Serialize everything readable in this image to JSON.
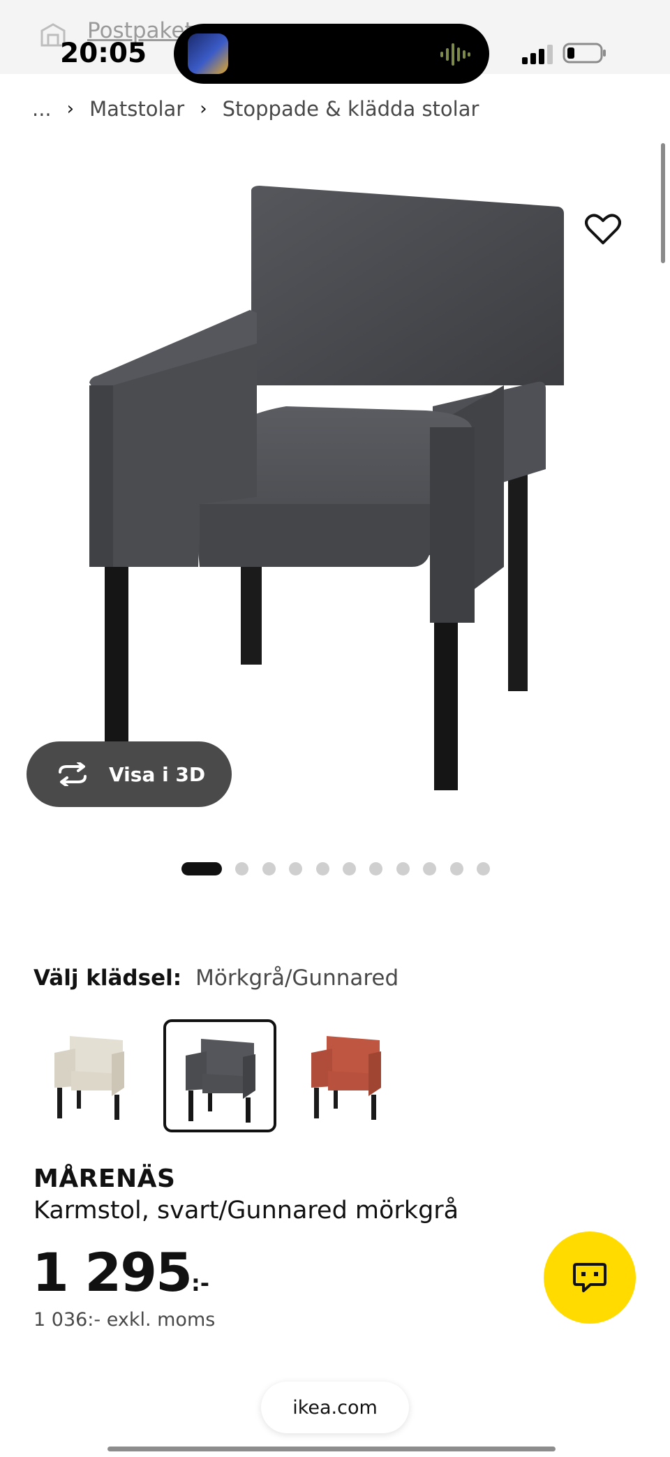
{
  "status_bar": {
    "time": "20:05",
    "background_link": "Postpaket"
  },
  "breadcrumb": {
    "ellipsis": "...",
    "items": [
      "Matstolar",
      "Stoppade & klädda stolar"
    ]
  },
  "gallery": {
    "view_3d_label": "Visa i 3D",
    "dot_count": 12,
    "active_dot": 0
  },
  "upholstery": {
    "label": "Välj klädsel:",
    "selected": "Mörkgrå/Gunnared",
    "options": [
      {
        "color": "#e4dfd3"
      },
      {
        "color": "#4a4b4f"
      },
      {
        "color": "#b9513e"
      }
    ],
    "selected_index": 1
  },
  "product": {
    "name": "MÅRENÄS",
    "description": "Karmstol, svart/Gunnared mörkgrå",
    "price": "1 295",
    "price_suffix": ":-",
    "price_ex_vat": "1 036:- exkl. moms"
  },
  "browser": {
    "url": "ikea.com"
  },
  "colors": {
    "chat_button": "#ffdb00",
    "view3d_button": "#4a4a4a",
    "accent_dark": "#111111"
  }
}
